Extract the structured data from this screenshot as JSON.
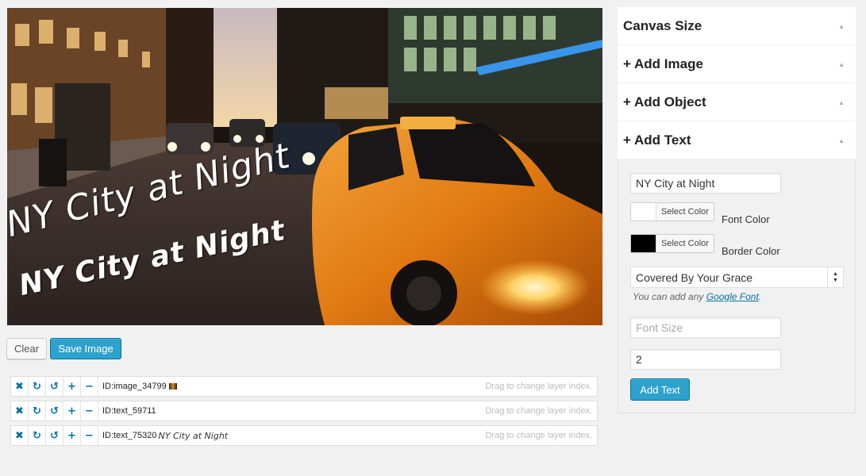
{
  "canvas": {
    "overlay_texts": [
      "NY City at Night",
      "NY City at Night"
    ]
  },
  "actions": {
    "clear_label": "Clear",
    "save_label": "Save Image"
  },
  "layers": [
    {
      "id_label": "ID:image_34799",
      "thumb_text": "",
      "hint": "Drag to change layer index."
    },
    {
      "id_label": "ID:text_59711",
      "thumb_text": "",
      "hint": "Drag to change layer index."
    },
    {
      "id_label": "ID:text_75320",
      "thumb_text": "NY City at Night",
      "hint": "Drag to change layer index."
    }
  ],
  "layer_tools": [
    "close-icon",
    "redo-icon",
    "undo-icon",
    "plus-icon",
    "minus-icon"
  ],
  "panel": {
    "sections": [
      "Canvas Size",
      "+ Add Image",
      "+ Add Object",
      "+ Add Text"
    ],
    "text_form": {
      "text_value": "NY City at Night",
      "font_color_button": "Select Color",
      "font_color_label": "Font Color",
      "font_color": "#ffffff",
      "border_color_button": "Select Color",
      "border_color_label": "Border Color",
      "border_color": "#000000",
      "font_family": "Covered By Your Grace",
      "hint_prefix": "You can add any ",
      "hint_link": "Google Font",
      "hint_suffix": ".",
      "font_size_placeholder": "Font Size",
      "border_width_value": "2",
      "submit_label": "Add Text"
    }
  },
  "colors": {
    "accent": "#2ea2cc",
    "link": "#0074a2",
    "background": "#f1f1f1"
  }
}
